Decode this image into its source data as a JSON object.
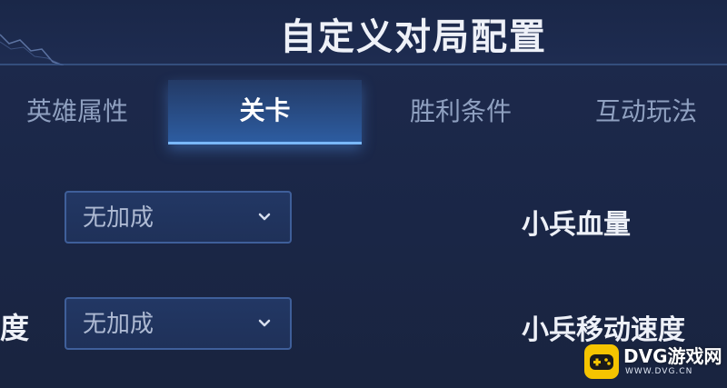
{
  "header": {
    "title": "自定义对局配置"
  },
  "tabs": [
    {
      "label": "英雄属性",
      "selected": false
    },
    {
      "label": "关卡",
      "selected": true
    },
    {
      "label": "胜利条件",
      "selected": false
    },
    {
      "label": "互动玩法",
      "selected": false
    }
  ],
  "rows": [
    {
      "left_label": "",
      "select_value": "无加成",
      "right_label": "小兵血量"
    },
    {
      "left_label": "度",
      "select_value": "无加成",
      "right_label": "小兵移动速度"
    }
  ],
  "watermark": {
    "name": "DVG游戏网",
    "url": "WWW.DVG.CN"
  },
  "colors": {
    "background": "#1b2748",
    "tab_active": "#2e5fa5",
    "tab_active_border": "#7ab8ff",
    "select_border": "#3f5f9a",
    "watermark_logo": "#f5c400"
  },
  "icons": {
    "dropdown": "chevron-down-icon",
    "watermark_logo": "gamepad-logo-icon"
  }
}
